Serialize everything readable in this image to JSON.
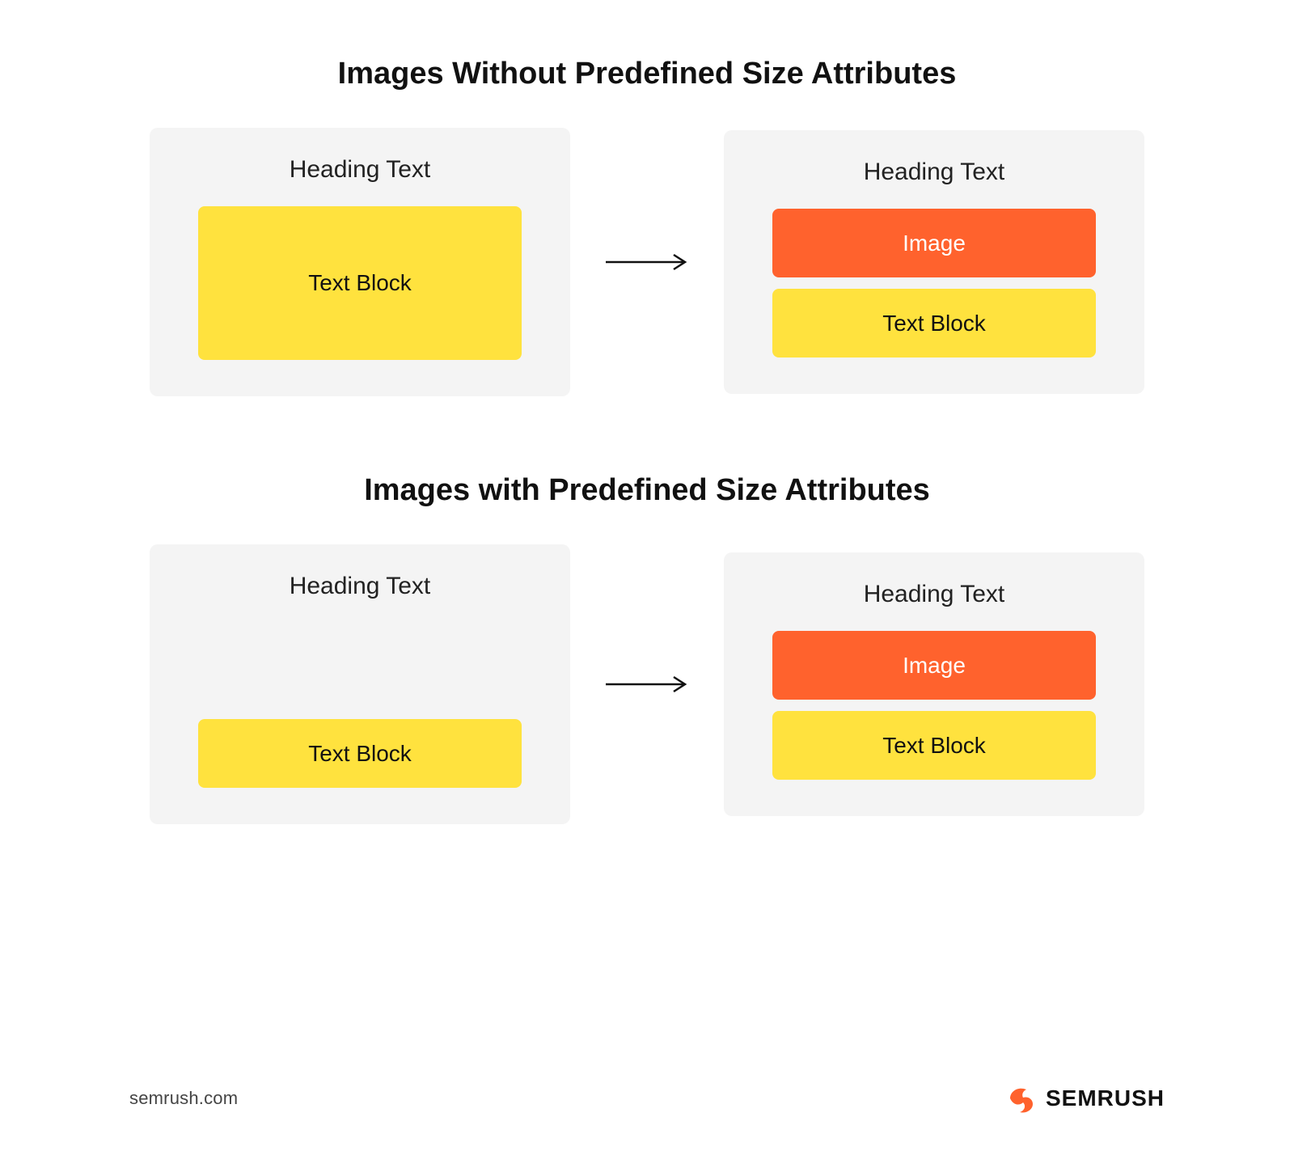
{
  "section1": {
    "title": "Images Without Predefined Size Attributes",
    "left": {
      "heading": "Heading Text",
      "textblock": "Text Block"
    },
    "right": {
      "heading": "Heading Text",
      "image": "Image",
      "textblock": "Text Block"
    }
  },
  "section2": {
    "title": "Images with Predefined Size Attributes",
    "left": {
      "heading": "Heading Text",
      "textblock": "Text Block"
    },
    "right": {
      "heading": "Heading Text",
      "image": "Image",
      "textblock": "Text Block"
    }
  },
  "footer": {
    "site": "semrush.com",
    "brand": "SEMRUSH"
  },
  "colors": {
    "cardBg": "#f4f4f4",
    "yellow": "#ffe23e",
    "orange": "#ff622d",
    "text": "#111111"
  }
}
